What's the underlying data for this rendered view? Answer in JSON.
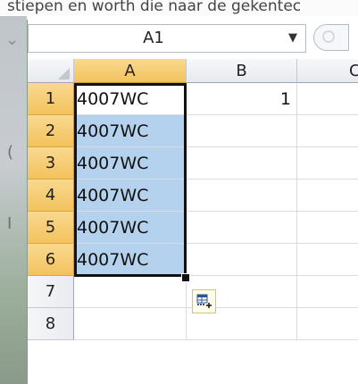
{
  "backdrop": {
    "partial_text": "stiepen en worth die naar de gekentec"
  },
  "name_box": {
    "value": "A1"
  },
  "columns": [
    "A",
    "B",
    "C"
  ],
  "rows": [
    {
      "num": "1",
      "a": "4007WC",
      "b": "1"
    },
    {
      "num": "2",
      "a": "4007WC",
      "b": ""
    },
    {
      "num": "3",
      "a": "4007WC",
      "b": ""
    },
    {
      "num": "4",
      "a": "4007WC",
      "b": ""
    },
    {
      "num": "5",
      "a": "4007WC",
      "b": ""
    },
    {
      "num": "6",
      "a": "4007WC",
      "b": ""
    },
    {
      "num": "7",
      "a": "",
      "b": ""
    },
    {
      "num": "8",
      "a": "",
      "b": ""
    }
  ],
  "colors": {
    "selection_fill": "#b4d2ee",
    "header_selected": "#f3c25c",
    "border": "#111111"
  },
  "icons": {
    "autofill_options": "auto-fill-options-icon",
    "corner": "select-all-corner-icon"
  }
}
